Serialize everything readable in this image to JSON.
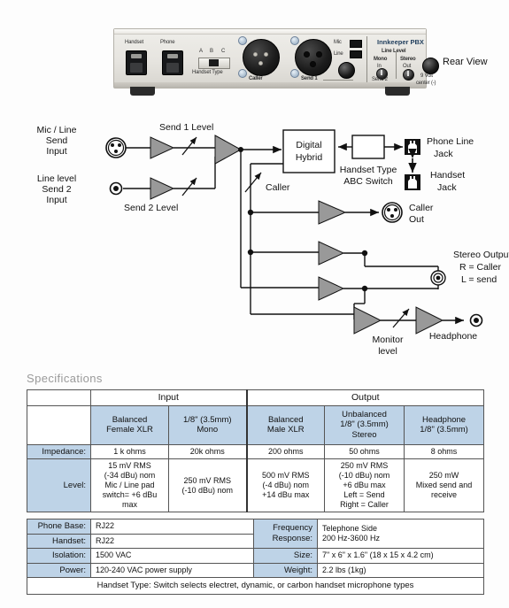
{
  "rear_view": {
    "label": "Rear View",
    "brand": "Innkeeper PBX",
    "panel_labels": {
      "handset": "Handset",
      "phone": "Phone",
      "abc_a": "A",
      "abc_b": "B",
      "abc_c": "C",
      "handset_type": "Handset Type",
      "caller": "Caller",
      "send1": "Send 1",
      "mic": "Mic",
      "line": "Line",
      "line_level": "Line Level",
      "mono": "Mono",
      "in": "In",
      "send2": "Send 2",
      "stereo": "Stereo",
      "out": "Out",
      "volt": "9 Volt",
      "center": "center (-)"
    }
  },
  "diagram": {
    "mic_line_send_input": "Mic / Line\nSend\nInput",
    "mic_line_l1": "Mic / Line",
    "mic_line_l2": "Send",
    "mic_line_l3": "Input",
    "line_level_l1": "Line level",
    "line_level_l2": "Send 2",
    "line_level_l3": "Input",
    "send1_level": "Send 1 Level",
    "send2_level": "Send 2 Level",
    "digital_hybrid_l1": "Digital",
    "digital_hybrid_l2": "Hybrid",
    "handset_type_l1": "Handset Type",
    "handset_type_l2": "ABC Switch",
    "phone_line_jack_l1": "Phone Line",
    "phone_line_jack_l2": "Jack",
    "handset_jack_l1": "Handset",
    "handset_jack_l2": "Jack",
    "caller": "Caller",
    "caller_out_l1": "Caller",
    "caller_out_l2": "Out",
    "stereo_output_l1": "Stereo Output",
    "stereo_output_l2": "R = Caller",
    "stereo_output_l3": "L = send",
    "monitor_level_l1": "Monitor",
    "monitor_level_l2": "level",
    "headphone": "Headphone"
  },
  "specifications": {
    "heading": "Specifications",
    "group_headers": {
      "input": "Input",
      "output": "Output"
    },
    "column_headers": [
      "Balanced\nFemale XLR",
      "1/8\" (3.5mm)\nMono",
      "Balanced\nMale XLR",
      "Unbalanced\n1/8\" (3.5mm)\nStereo",
      "Headphone\n1/8\" (3.5mm)"
    ],
    "col_headers_lines": [
      [
        "Balanced",
        "Female XLR"
      ],
      [
        "1/8\" (3.5mm)",
        "Mono"
      ],
      [
        "Balanced",
        "Male XLR"
      ],
      [
        "Unbalanced",
        "1/8\" (3.5mm)",
        "Stereo"
      ],
      [
        "Headphone",
        "1/8\" (3.5mm)"
      ]
    ],
    "impedance_label": "Impedance:",
    "impedance_values": [
      "1 k ohms",
      "20k ohms",
      "200 ohms",
      "50 ohms",
      "8 ohms"
    ],
    "level_label": "Level:",
    "level_values_lines": [
      [
        "15 mV RMS",
        "(-34 dBu) nom",
        "Mic / Line pad",
        "switch= +6 dBu",
        "max"
      ],
      [
        "250 mV RMS",
        "(-10 dBu) nom"
      ],
      [
        "500 mV RMS",
        "(-4 dBu) nom",
        "+14 dBu max"
      ],
      [
        "250 mV RMS",
        "(-10 dBu) nom",
        "+6 dBu max",
        "Left = Send",
        "Right = Caller"
      ],
      [
        "250 mW",
        "Mixed send and",
        "receive"
      ]
    ],
    "bottom_rows": [
      {
        "label": "Phone Base:",
        "value": "RJ22",
        "label2_lines": [
          "Frequency",
          "Response:"
        ],
        "value2_lines": [
          "Telephone Side",
          "200 Hz-3600 Hz"
        ]
      },
      {
        "label": "Handset:",
        "value": "RJ22"
      },
      {
        "label": "Isolation:",
        "value": "1500 VAC",
        "label2": "Size:",
        "value2": "7\" x 6\" x 1.6\" (18 x 15 x 4.2 cm)"
      },
      {
        "label": "Power:",
        "value": "120-240 VAC power supply",
        "label2": "Weight:",
        "value2": "2.2 lbs (1kg)"
      }
    ],
    "footer": "Handset Type: Switch selects electret, dynamic, or carbon handset microphone types"
  },
  "colors": {
    "header_blue": "#bed3e7",
    "amp_gray": "#999999",
    "heading_gray": "#9a9a9a",
    "background": "#fdfdfd"
  }
}
